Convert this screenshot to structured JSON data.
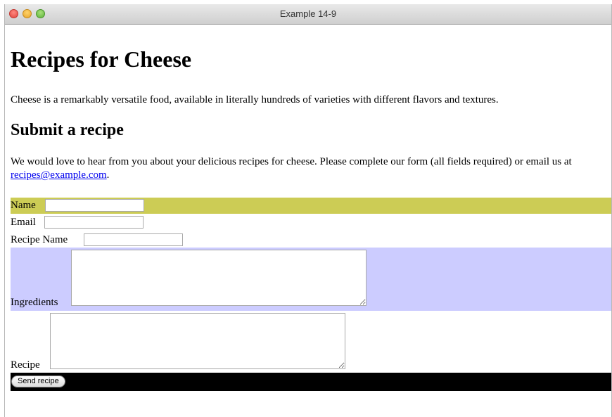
{
  "window": {
    "title": "Example 14-9"
  },
  "page": {
    "heading": "Recipes for Cheese",
    "intro": "Cheese is a remarkably versatile food, available in literally hundreds of varieties with different flavors and textures.",
    "subheading": "Submit a recipe",
    "description": "We would love to hear from you about your delicious recipes for cheese. Please complete our form (all fields required) or email us at ",
    "email_link": "recipes@example.com",
    "description_end": "."
  },
  "form": {
    "name_label": "Name",
    "name_value": "",
    "email_label": "Email",
    "email_value": "",
    "recipe_name_label": "Recipe Name",
    "recipe_name_value": "",
    "ingredients_label": "Ingredients",
    "ingredients_value": "",
    "recipe_label": "Recipe",
    "recipe_value": "",
    "submit_label": "Send recipe"
  },
  "colors": {
    "name_row": "#cccc55",
    "ingredients_row": "#ccccff",
    "submit_row": "#000000",
    "link": "#0000ee"
  }
}
